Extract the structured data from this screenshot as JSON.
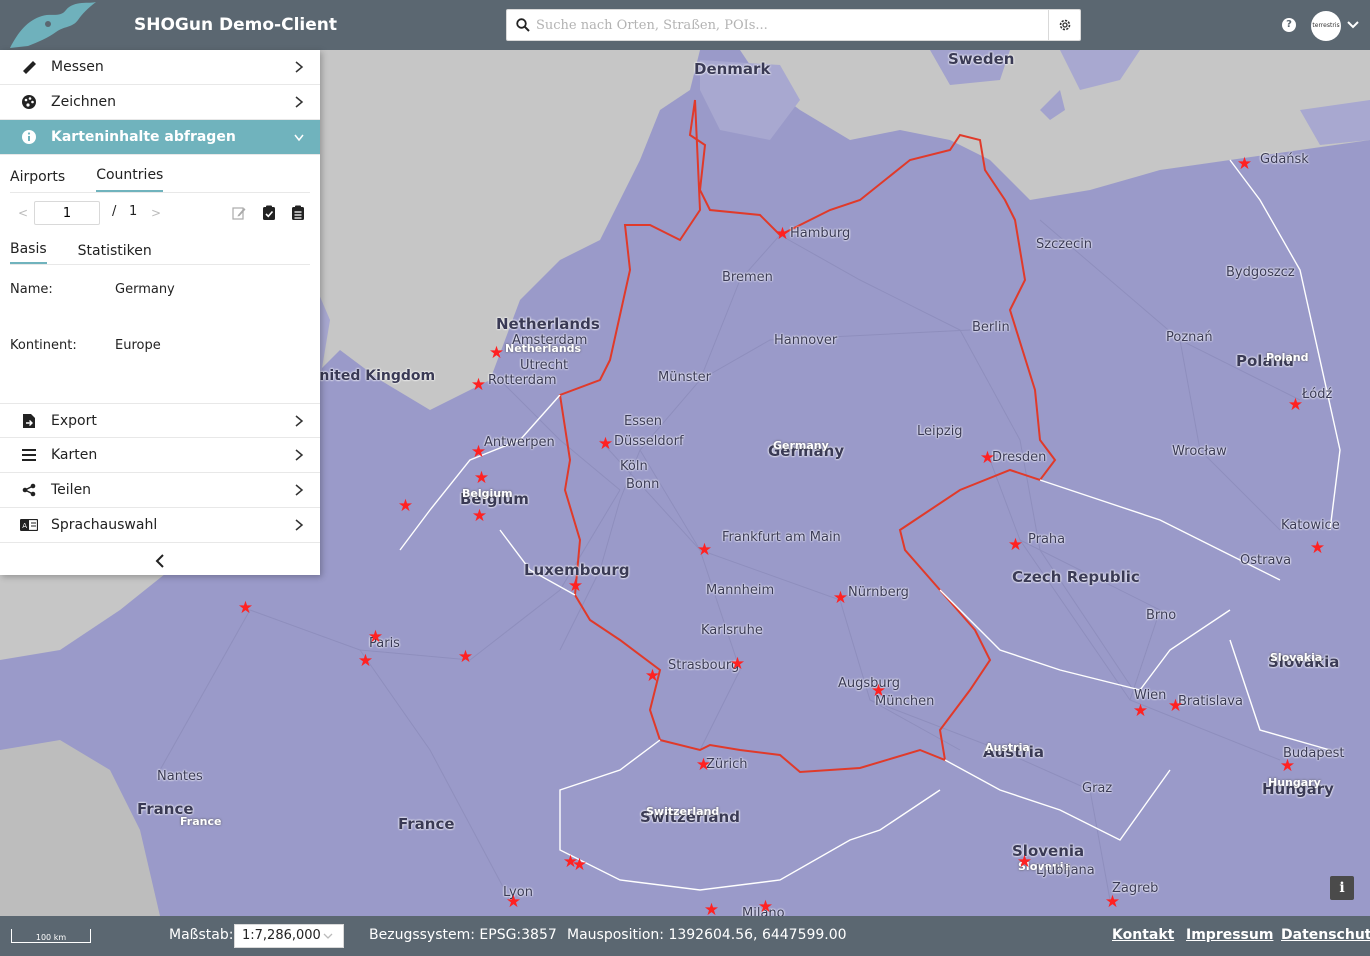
{
  "header": {
    "title": "SHOGun Demo-Client",
    "search_placeholder": "Suche nach Orten, Straßen, POIs...",
    "help_label": "?",
    "avatar_text": "terrestris"
  },
  "panel": {
    "items_top": [
      {
        "label": "Messen",
        "icon": "ruler-icon"
      },
      {
        "label": "Zeichnen",
        "icon": "palette-icon"
      }
    ],
    "active_item": {
      "label": "Karteninhalte abfragen",
      "icon": "info-icon"
    },
    "layer_tabs": [
      "Airports",
      "Countries"
    ],
    "active_layer_tab": "Countries",
    "pager": {
      "current": "1",
      "separator": "/",
      "total": "1"
    },
    "detail_tabs": [
      "Basis",
      "Statistiken"
    ],
    "fields": [
      {
        "key": "Name",
        "sep": ":",
        "value": "Germany"
      },
      {
        "key": "Kontinent",
        "sep": ":",
        "value": "Europe"
      }
    ],
    "items_bottom": [
      {
        "label": "Export",
        "icon": "file-export-icon"
      },
      {
        "label": "Karten",
        "icon": "bars-icon"
      },
      {
        "label": "Teilen",
        "icon": "share-icon"
      },
      {
        "label": "Sprachauswahl",
        "icon": "language-icon"
      }
    ]
  },
  "map": {
    "highlight_color": "#e03a2a",
    "star_color": "#ff2222",
    "cities": [
      "Hamburg",
      "Bremen",
      "Berlin",
      "Hannover",
      "Münster",
      "Essen",
      "Düsseldorf",
      "Köln",
      "Bonn",
      "Leipzig",
      "Dresden",
      "Frankfurt am Main",
      "Mannheim",
      "Nürnberg",
      "Karlsruhe",
      "Strasbourg",
      "Augsburg",
      "München",
      "Zürich",
      "Szczecin",
      "Bydgoszcz",
      "Poznań",
      "Gdańsk",
      "Łódź",
      "Wrocław",
      "Katowice",
      "Ostrava",
      "Praha",
      "Brno",
      "Wien",
      "Bratislava",
      "Budapest",
      "Graz",
      "Zagreb",
      "Ljubljana",
      "Amsterdam",
      "Utrecht",
      "Rotterdam",
      "Antwerpen",
      "Paris",
      "Nantes",
      "Lyon",
      "Milano"
    ],
    "countries": [
      "Denmark",
      "Sweden",
      "Netherlands",
      "Germany",
      "Belgium",
      "Luxembourg",
      "Czech Republic",
      "Poland",
      "Slovakia",
      "Austria",
      "Hungary",
      "Switzerland",
      "France",
      "Slovenia",
      "United Kingdom"
    ],
    "info_label": "i"
  },
  "footer": {
    "scalebar_label": "100 km",
    "scale_label": "Maßstab:",
    "scale_value": "1:7,286,000",
    "crs_text": "Bezugssystem: EPSG:3857",
    "mouse_text": "Mausposition: 1392604.56, 6447599.00",
    "links": [
      "Kontakt",
      "Impressum",
      "Datenschutz"
    ]
  }
}
